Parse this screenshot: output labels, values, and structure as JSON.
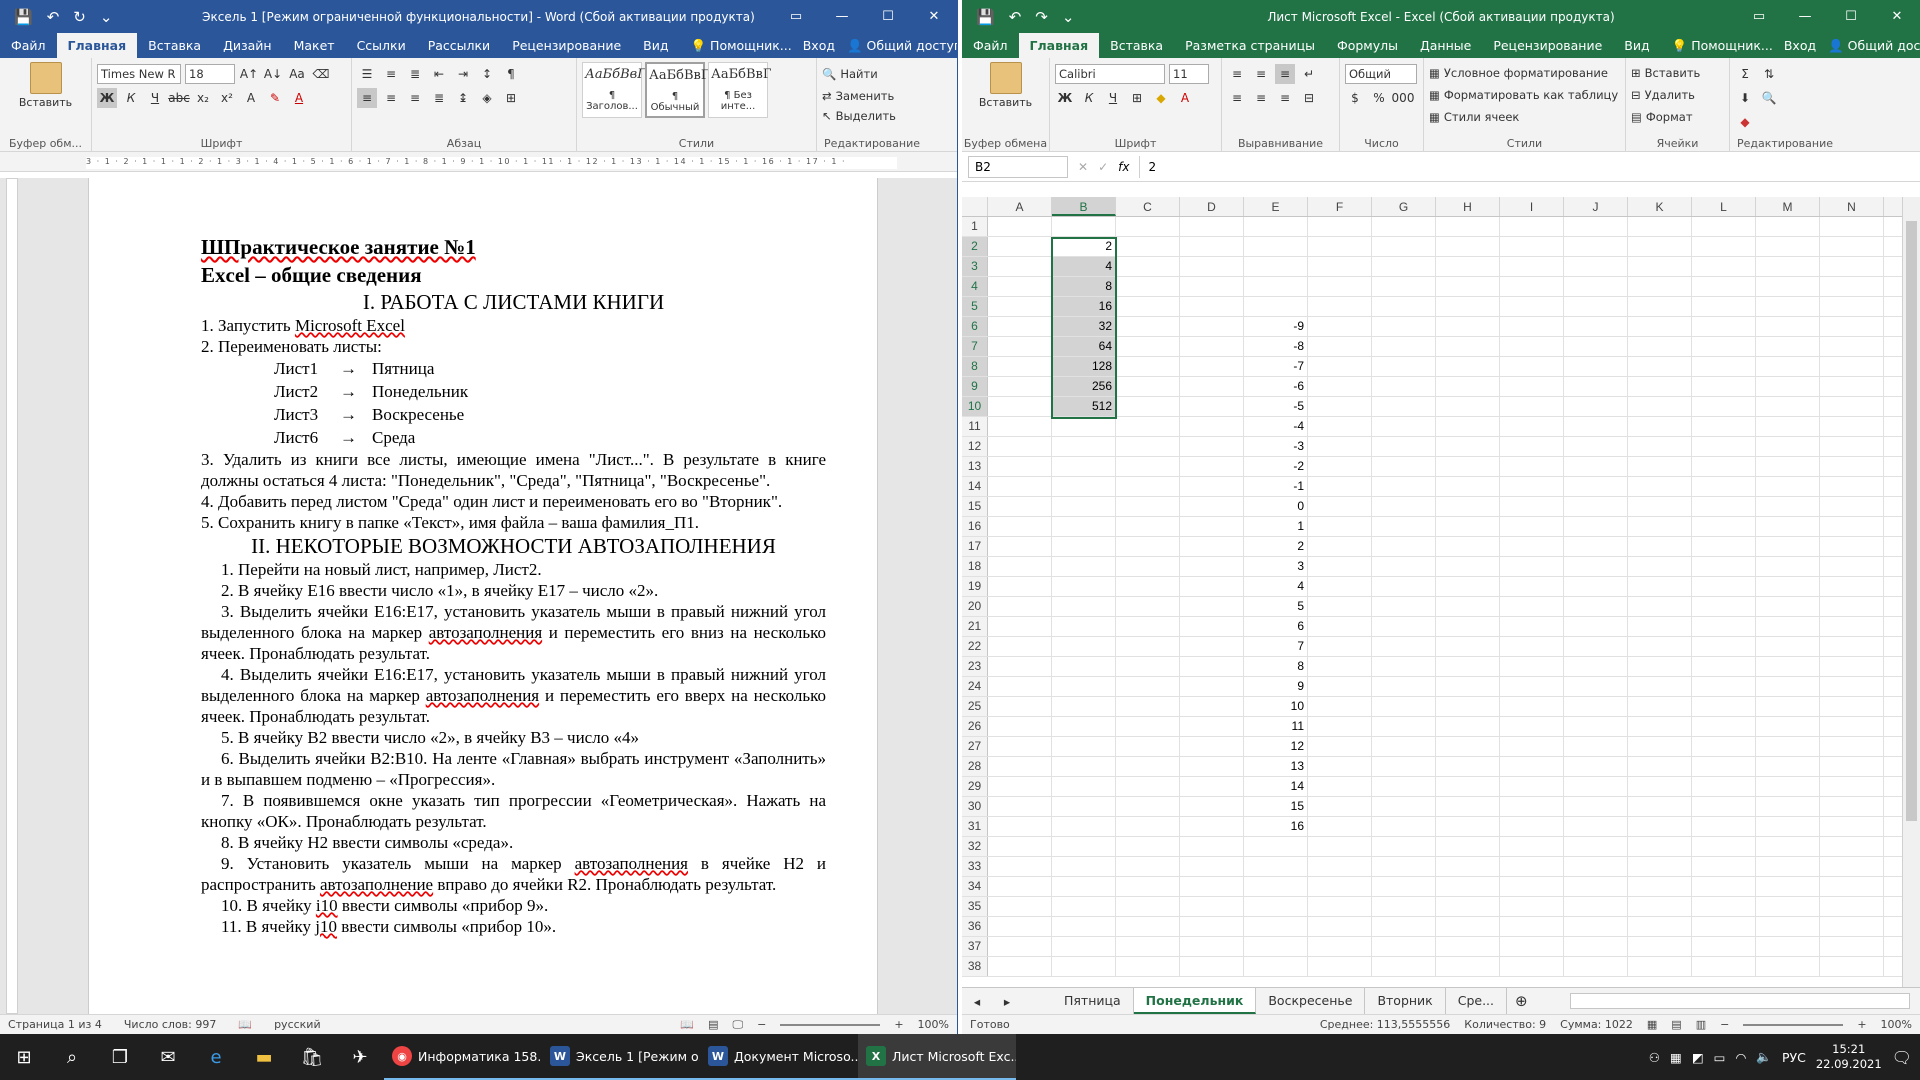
{
  "word": {
    "title": "Эксель 1 [Режим ограниченной функциональности] - Word (Сбой активации продукта)",
    "tabs": [
      "Файл",
      "Главная",
      "Вставка",
      "Дизайн",
      "Макет",
      "Ссылки",
      "Рассылки",
      "Рецензирование",
      "Вид"
    ],
    "tell_me": "Помощник...",
    "signin": "Вход",
    "share": "Общий доступ",
    "ribbon": {
      "paste": "Вставить",
      "font_name": "Times New R",
      "font_size": "18",
      "styles": [
        "АаБбВвГ",
        "АаБбВвГ",
        "АаБбВвГ"
      ],
      "style_names": [
        "¶ Заголов...",
        "¶ Обычный",
        "¶ Без инте..."
      ],
      "find": "Найти",
      "replace": "Заменить",
      "select": "Выделить",
      "groups": [
        "Буфер обм...",
        "Шрифт",
        "Абзац",
        "Стили",
        "Редактирование"
      ]
    },
    "ruler": "3 · 1 · 2 · 1 · 1 · 1 · 2 · 1 · 3 · 1 · 4 · 1 · 5 · 1 · 6 · 1 · 7 · 1 · 8 · 1 · 9 · 1 · 10 · 1 · 11 · 1 · 12 · 1 · 13 · 1 · 14 · 1 · 15 · 1 · 16 · 1 · 17 · 1 ·",
    "doc": {
      "t1": "ШПрактическое занятие №1",
      "t2": "Excel – общие сведения",
      "s1": "I. РАБОТА С ЛИСТАМИ КНИГИ",
      "p1a": "1. Запустить ",
      "p1b": "Microsoft Excel",
      "p2": "2. Переименовать листы:",
      "renames": [
        [
          "Лист1",
          "→",
          "Пятница"
        ],
        [
          "Лист2",
          "→",
          "Понедельник"
        ],
        [
          "Лист3",
          "→",
          "Воскресенье"
        ],
        [
          "Лист6",
          "→",
          "Среда"
        ]
      ],
      "p3": "3. Удалить из книги все листы, имеющие имена \"Лист...\". В результате в книге должны остаться 4 листа: \"Понедельник\", \"Среда\", \"Пятница\", \"Воскресенье\".",
      "p4": "4. Добавить перед листом \"Среда\" один лист и переименовать его во \"Вторник\".",
      "p5": "5. Сохранить книгу в папке «Текст», имя файла – ваша фамилия_П1.",
      "s2": "II. НЕКОТОРЫЕ ВОЗМОЖНОСТИ АВТОЗАПОЛНЕНИЯ",
      "l1": "1.    Перейти на новый лист, например, Лист2.",
      "l2": "2.    В ячейку Е16 ввести число «1», в ячейку Е17 – число «2».",
      "l3a": "3.    Выделить ячейки Е16:Е17, установить указатель мыши в правый нижний угол выделенного блока на маркер ",
      "l3b": "автозаполнения",
      "l3c": " и переместить его вниз на несколько ячеек. Пронаблюдать результат.",
      "l4a": "4.    Выделить ячейки Е16:Е17, установить указатель мыши в правый нижний угол выделенного блока на маркер ",
      "l4b": "автозаполнения",
      "l4c": " и переместить его вверх на несколько ячеек. Пронаблюдать результат.",
      "l5": "5.    В ячейку В2 ввести число «2», в ячейку В3 – число «4»",
      "l6": "6.    Выделить ячейки В2:В10. На ленте «Главная» выбрать инструмент «Заполнить» и в выпавшем подменю – «Прогрессия».",
      "l7": "7.    В появившемся окне указать тип прогрессии «Геометрическая». Нажать на кнопку «ОК». Пронаблюдать результат.",
      "l8": "8.    В ячейку Н2 ввести символы «среда».",
      "l9a": "9.    Установить указатель мыши на маркер ",
      "l9b": "автозаполнения",
      "l9c": " в ячейке Н2 и распространить ",
      "l9d": "автозаполнение",
      "l9e": " вправо до ячейки R2. Пронаблюдать результат.",
      "l10a": "10. В ячейку ",
      "l10b": "i10",
      "l10c": " ввести символы «прибор 9».",
      "l11a": "11. В ячейку ",
      "l11b": "j10",
      "l11c": " ввести символы «прибор 10»."
    },
    "status": {
      "page": "Страница 1 из 4",
      "words": "Число слов: 997",
      "lang": "русский",
      "zoom": "100%"
    }
  },
  "excel": {
    "title": "Лист Microsoft Excel - Excel (Сбой активации продукта)",
    "tabs": [
      "Файл",
      "Главная",
      "Вставка",
      "Разметка страницы",
      "Формулы",
      "Данные",
      "Рецензирование",
      "Вид"
    ],
    "tell_me": "Помощник...",
    "signin": "Вход",
    "share": "Общий доступ",
    "ribbon": {
      "paste": "Вставить",
      "font_name": "Calibri",
      "font_size": "11",
      "number_format": "Общий",
      "cond": "Условное форматирование",
      "astable": "Форматировать как таблицу",
      "cellstyles": "Стили ячеек",
      "insert": "Вставить",
      "delete": "Удалить",
      "format": "Формат",
      "groups": [
        "Буфер обмена",
        "Шрифт",
        "Выравнивание",
        "Число",
        "Стили",
        "Ячейки",
        "Редактирование"
      ]
    },
    "namebox": "B2",
    "fx": "fx",
    "formula": "2",
    "columns": [
      "A",
      "B",
      "C",
      "D",
      "E",
      "F",
      "G",
      "H",
      "I",
      "J",
      "K",
      "L",
      "M",
      "N"
    ],
    "rows": [
      {
        "n": "1",
        "b": "",
        "e": ""
      },
      {
        "n": "2",
        "b": "2",
        "e": ""
      },
      {
        "n": "3",
        "b": "4",
        "e": ""
      },
      {
        "n": "4",
        "b": "8",
        "e": ""
      },
      {
        "n": "5",
        "b": "16",
        "e": ""
      },
      {
        "n": "6",
        "b": "32",
        "e": "-9"
      },
      {
        "n": "7",
        "b": "64",
        "e": "-8"
      },
      {
        "n": "8",
        "b": "128",
        "e": "-7"
      },
      {
        "n": "9",
        "b": "256",
        "e": "-6"
      },
      {
        "n": "10",
        "b": "512",
        "e": "-5"
      },
      {
        "n": "11",
        "b": "",
        "e": "-4"
      },
      {
        "n": "12",
        "b": "",
        "e": "-3"
      },
      {
        "n": "13",
        "b": "",
        "e": "-2"
      },
      {
        "n": "14",
        "b": "",
        "e": "-1"
      },
      {
        "n": "15",
        "b": "",
        "e": "0"
      },
      {
        "n": "16",
        "b": "",
        "e": "1"
      },
      {
        "n": "17",
        "b": "",
        "e": "2"
      },
      {
        "n": "18",
        "b": "",
        "e": "3"
      },
      {
        "n": "19",
        "b": "",
        "e": "4"
      },
      {
        "n": "20",
        "b": "",
        "e": "5"
      },
      {
        "n": "21",
        "b": "",
        "e": "6"
      },
      {
        "n": "22",
        "b": "",
        "e": "7"
      },
      {
        "n": "23",
        "b": "",
        "e": "8"
      },
      {
        "n": "24",
        "b": "",
        "e": "9"
      },
      {
        "n": "25",
        "b": "",
        "e": "10"
      },
      {
        "n": "26",
        "b": "",
        "e": "11"
      },
      {
        "n": "27",
        "b": "",
        "e": "12"
      },
      {
        "n": "28",
        "b": "",
        "e": "13"
      },
      {
        "n": "29",
        "b": "",
        "e": "14"
      },
      {
        "n": "30",
        "b": "",
        "e": "15"
      },
      {
        "n": "31",
        "b": "",
        "e": "16"
      },
      {
        "n": "32",
        "b": "",
        "e": ""
      },
      {
        "n": "33",
        "b": "",
        "e": ""
      },
      {
        "n": "34",
        "b": "",
        "e": ""
      },
      {
        "n": "35",
        "b": "",
        "e": ""
      },
      {
        "n": "36",
        "b": "",
        "e": ""
      },
      {
        "n": "37",
        "b": "",
        "e": ""
      },
      {
        "n": "38",
        "b": "",
        "e": ""
      }
    ],
    "sheets": [
      "Пятница",
      "Понедельник",
      "Воскресенье",
      "Вторник",
      "Сре..."
    ],
    "status": {
      "ready": "Готово",
      "avg": "Среднее: 113,5555556",
      "count": "Количество: 9",
      "sum": "Сумма: 1022",
      "zoom": "100%"
    }
  },
  "taskbar": {
    "apps": [
      "Информатика 158...",
      "Эксель 1 [Режим о...",
      "Документ Microso...",
      "Лист Microsoft Exc..."
    ],
    "lang": "РУС",
    "time": "15:21",
    "date": "22.09.2021"
  }
}
